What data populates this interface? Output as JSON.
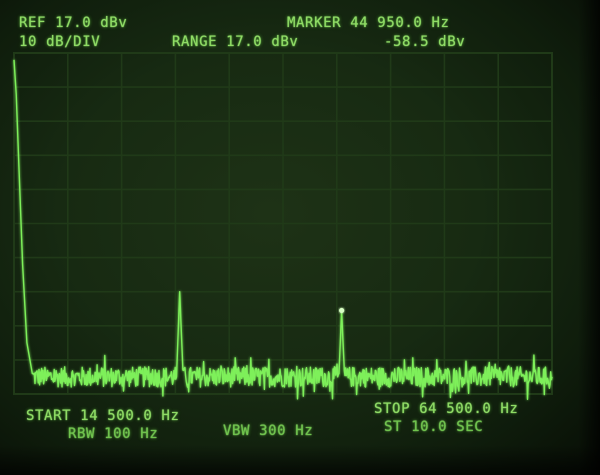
{
  "header": {
    "ref_label": "REF 17.0 dBv",
    "scale_label": "10 dB/DIV",
    "range_label": "RANGE 17.0 dBv",
    "marker_freq_label": "MARKER 44 950.0 Hz",
    "marker_level_label": "-58.5 dBv"
  },
  "footer": {
    "start_label": "START 14 500.0 Hz",
    "stop_label": "STOP 64 500.0 Hz",
    "rbw_label": "RBW 100 Hz",
    "vbw_label": "VBW 300 Hz",
    "sweep_time_label": "ST 10.0 SEC"
  },
  "colors": {
    "trace": "#7ef05a",
    "grid": "#203a18",
    "text": "#8fdc64"
  },
  "chart_data": {
    "type": "line",
    "x_unit": "Hz",
    "y_unit": "dBv",
    "xlim": [
      14500,
      64500
    ],
    "ylim": [
      -83,
      17
    ],
    "x_divisions": 10,
    "y_divisions": 10,
    "grid": true,
    "series": [
      {
        "points": [
          [
            14500,
            15
          ],
          [
            14700,
            5
          ],
          [
            15000,
            -20
          ],
          [
            15300,
            -45
          ],
          [
            15700,
            -68
          ],
          [
            16200,
            -77
          ],
          [
            17500,
            -79
          ],
          [
            20000,
            -78
          ],
          [
            24500,
            -79
          ],
          [
            29600,
            -78
          ],
          [
            29900,
            -53
          ],
          [
            30200,
            -76
          ],
          [
            35000,
            -79
          ],
          [
            40000,
            -78
          ],
          [
            44700,
            -77
          ],
          [
            44950,
            -58.5
          ],
          [
            45200,
            -76
          ],
          [
            50000,
            -79
          ],
          [
            55000,
            -78
          ],
          [
            60000,
            -79
          ],
          [
            64500,
            -78
          ]
        ],
        "noise_floor": -78,
        "noise_span_db": 6
      }
    ],
    "marker": {
      "x": 44950,
      "y": -58.5
    }
  }
}
